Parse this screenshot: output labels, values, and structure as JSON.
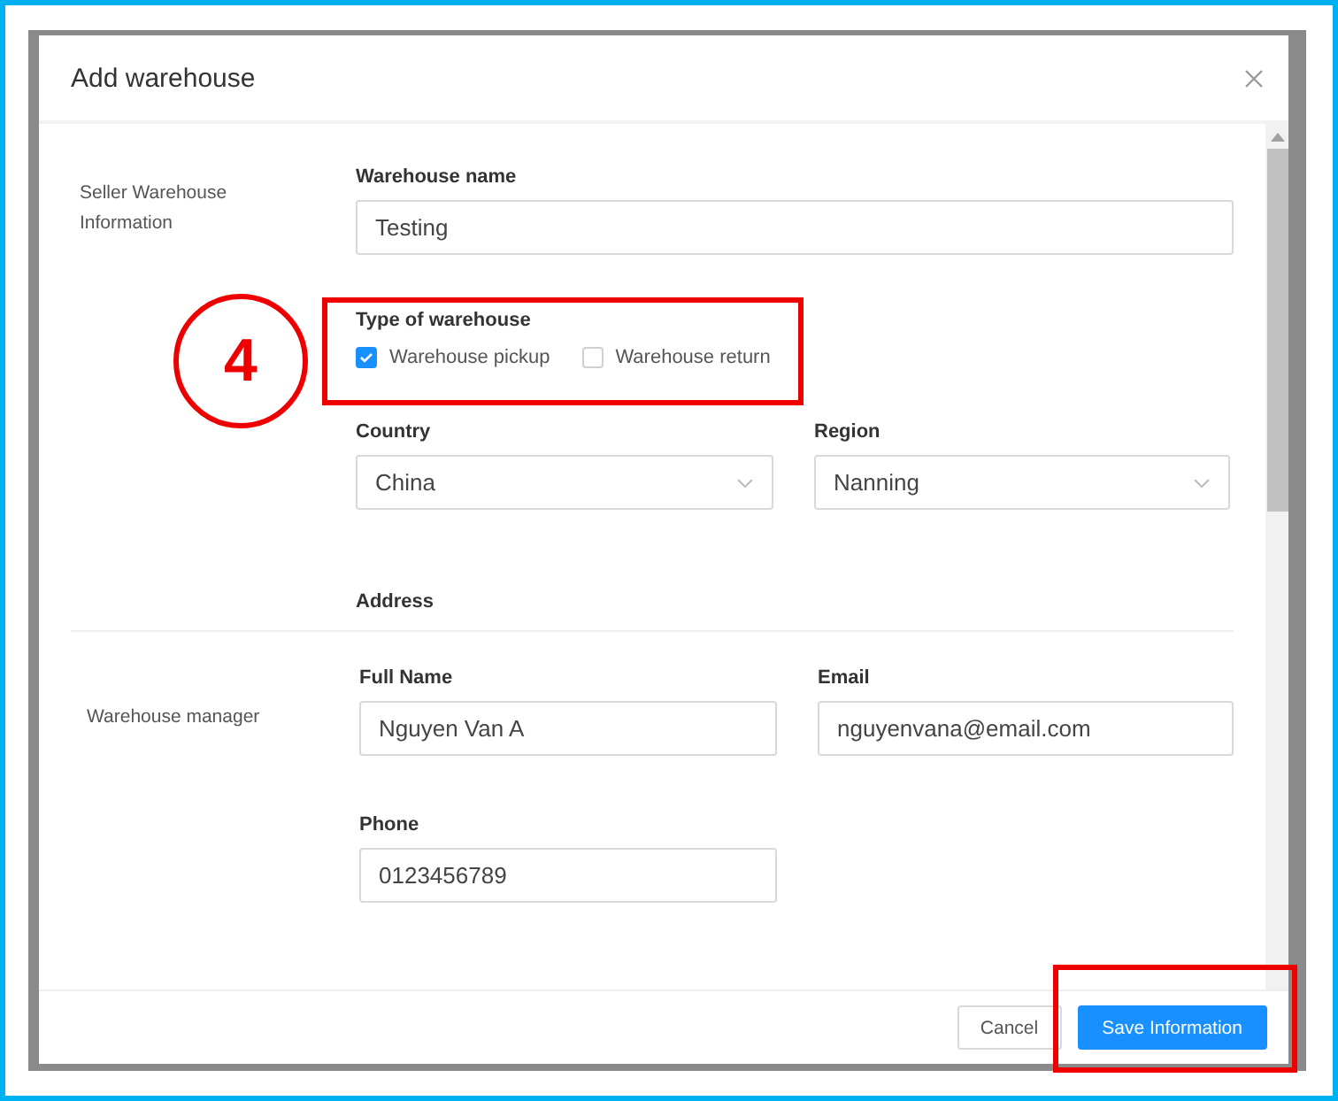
{
  "dialog": {
    "title": "Add warehouse"
  },
  "seller_section": {
    "label": "Seller Warehouse Information",
    "warehouse_name": {
      "label": "Warehouse name",
      "value": "Testing"
    },
    "type_of_warehouse": {
      "label": "Type of warehouse",
      "options": [
        {
          "label": "Warehouse pickup",
          "checked": true
        },
        {
          "label": "Warehouse return",
          "checked": false
        }
      ]
    },
    "selects": [
      {
        "label": "Country",
        "value": "China"
      },
      {
        "label": "Region",
        "value": "Nanning"
      }
    ],
    "address_label": "Address"
  },
  "manager_section": {
    "label": "Warehouse manager",
    "fields": [
      {
        "label": "Full Name",
        "value": "Nguyen Van A"
      },
      {
        "label": "Email",
        "value": "nguyenvana@email.com"
      },
      {
        "label": "Phone",
        "value": "0123456789"
      }
    ]
  },
  "footer": {
    "buttons": [
      {
        "label": "Cancel",
        "kind": "secondary"
      },
      {
        "label": "Save Information",
        "kind": "primary"
      }
    ]
  },
  "annotation": {
    "step": "4"
  }
}
